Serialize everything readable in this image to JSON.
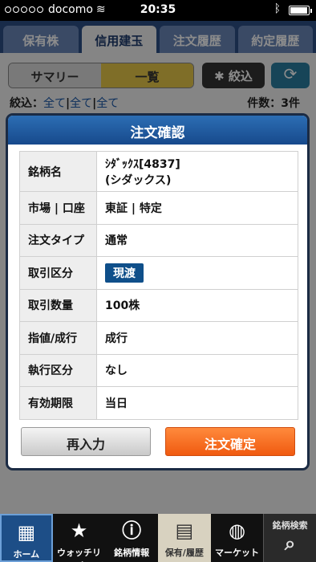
{
  "status_bar": {
    "carrier": "docomo",
    "time": "20:35",
    "bluetooth_icon": "bluetooth-icon",
    "wifi_icon": "wifi-icon"
  },
  "top_tabs": [
    {
      "label": "保有株"
    },
    {
      "label": "信用建玉"
    },
    {
      "label": "注文履歴"
    },
    {
      "label": "約定履歴"
    }
  ],
  "segment": {
    "summary": "サマリー",
    "list": "一覧",
    "filter": "絞込",
    "refresh_icon": "refresh-icon"
  },
  "filter_line": {
    "label": "絞込：",
    "values": [
      "全て",
      "全て",
      "全て"
    ],
    "separator": "|",
    "count": "件数：3件"
  },
  "modal": {
    "title": "注文確認",
    "rows": [
      {
        "key": "銘柄名",
        "value": "ｼﾀﾞｯｸｽ[4837]",
        "value2": "(シダックス)"
      },
      {
        "key": "市場 | 口座",
        "value": "東証 | 特定"
      },
      {
        "key": "注文タイプ",
        "value": "通常"
      },
      {
        "key": "取引区分",
        "value": "現渡"
      },
      {
        "key": "取引数量",
        "value": "100株"
      },
      {
        "key": "指値/成行",
        "value": "成行"
      },
      {
        "key": "執行区分",
        "value": "なし"
      },
      {
        "key": "有効期限",
        "value": "当日"
      }
    ],
    "reenter_label": "再入力",
    "confirm_label": "注文確定"
  },
  "bottom_tabs": [
    {
      "label": "ホーム",
      "icon": "home-icon"
    },
    {
      "label": "ウォッチリスト",
      "icon": "star-folder-icon"
    },
    {
      "label": "銘柄情報",
      "icon": "info-icon"
    },
    {
      "label": "保有/履歴",
      "icon": "clipboard-icon"
    },
    {
      "label": "マーケット",
      "icon": "globe-icon"
    },
    {
      "label": "銘柄検索",
      "icon": "search-icon"
    }
  ]
}
